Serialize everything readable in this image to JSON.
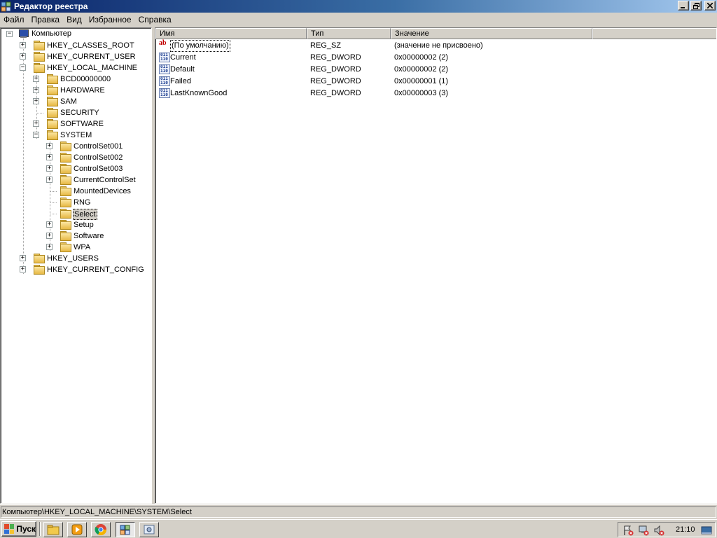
{
  "window": {
    "title": "Редактор реестра",
    "buttons": {
      "minimize": "_",
      "restore": "❐",
      "close": "✕"
    }
  },
  "menu": [
    "Файл",
    "Правка",
    "Вид",
    "Избранное",
    "Справка"
  ],
  "tree": {
    "root": "Компьютер",
    "nodes": [
      {
        "label": "HKEY_CLASSES_ROOT",
        "expander": "+"
      },
      {
        "label": "HKEY_CURRENT_USER",
        "expander": "+"
      },
      {
        "label": "HKEY_LOCAL_MACHINE",
        "expander": "−"
      },
      {
        "label": "BCD00000000",
        "expander": "+"
      },
      {
        "label": "HARDWARE",
        "expander": "+"
      },
      {
        "label": "SAM",
        "expander": "+"
      },
      {
        "label": "SECURITY",
        "expander": ""
      },
      {
        "label": "SOFTWARE",
        "expander": "+"
      },
      {
        "label": "SYSTEM",
        "expander": "−"
      },
      {
        "label": "ControlSet001",
        "expander": "+"
      },
      {
        "label": "ControlSet002",
        "expander": "+"
      },
      {
        "label": "ControlSet003",
        "expander": "+"
      },
      {
        "label": "CurrentControlSet",
        "expander": "+"
      },
      {
        "label": "MountedDevices",
        "expander": ""
      },
      {
        "label": "RNG",
        "expander": ""
      },
      {
        "label": "Select",
        "expander": ""
      },
      {
        "label": "Setup",
        "expander": "+"
      },
      {
        "label": "Software",
        "expander": "+"
      },
      {
        "label": "WPA",
        "expander": "+"
      },
      {
        "label": "HKEY_USERS",
        "expander": "+"
      },
      {
        "label": "HKEY_CURRENT_CONFIG",
        "expander": "+"
      }
    ]
  },
  "list": {
    "headers": {
      "name": "Имя",
      "type": "Тип",
      "value": "Значение"
    },
    "rows": [
      {
        "icon": "string-value-icon",
        "name": "(По умолчанию)",
        "type": "REG_SZ",
        "value": "(значение не присвоено)"
      },
      {
        "icon": "binary-value-icon",
        "name": "Current",
        "type": "REG_DWORD",
        "value": "0x00000002 (2)"
      },
      {
        "icon": "binary-value-icon",
        "name": "Default",
        "type": "REG_DWORD",
        "value": "0x00000002 (2)"
      },
      {
        "icon": "binary-value-icon",
        "name": "Failed",
        "type": "REG_DWORD",
        "value": "0x00000001 (1)"
      },
      {
        "icon": "binary-value-icon",
        "name": "LastKnownGood",
        "type": "REG_DWORD",
        "value": "0x00000003 (3)"
      }
    ],
    "icon_text": {
      "string": "ab",
      "binary_top": "011",
      "binary_bottom": "110"
    }
  },
  "status": {
    "path": "Компьютер\\HKEY_LOCAL_MACHINE\\SYSTEM\\Select"
  },
  "taskbar": {
    "start_label": "Пуск",
    "clock": "21:10"
  },
  "colors": {
    "title_start": "#0a246a",
    "title_end": "#a6caf0",
    "face": "#d4d0c8",
    "folder": "#e6b844"
  }
}
